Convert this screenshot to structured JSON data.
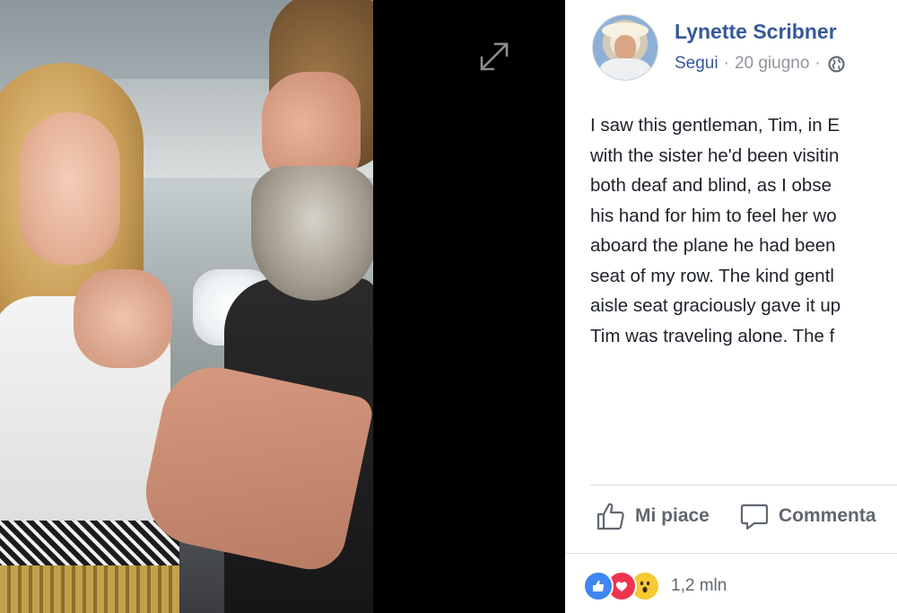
{
  "viewer": {
    "photo_alt": "",
    "expand_icon": "expand-icon"
  },
  "post": {
    "author": "Lynette Scribner",
    "follow_label": "Segui",
    "separator": "·",
    "date": "20 giugno",
    "privacy_icon": "globe-icon",
    "body_lines": [
      "I saw this gentleman, Tim, in E",
      "with the sister he'd been visitin",
      "both deaf and blind, as I obse",
      "his hand for him to feel her wo",
      "aboard the plane he had been",
      "seat of my row. The kind gentl",
      "aisle seat graciously gave it up",
      "Tim was traveling alone. The f"
    ]
  },
  "actions": {
    "like_label": "Mi piace",
    "comment_label": "Commenta"
  },
  "reactions": {
    "types": [
      "like",
      "love",
      "wow"
    ],
    "count": "1,2 mln"
  },
  "colors": {
    "link": "#365899",
    "muted": "#90949c",
    "text": "#1d2129",
    "like": "#3f86f2",
    "love": "#f0334f",
    "wow": "#f7c933"
  }
}
